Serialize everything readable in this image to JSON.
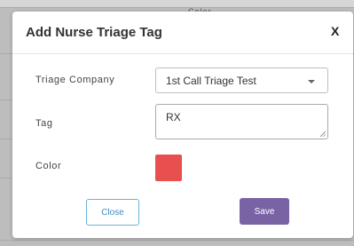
{
  "background": {
    "peek_text": "Color"
  },
  "dialog": {
    "title": "Add Nurse Triage Tag",
    "close_glyph": "X"
  },
  "form": {
    "triage_company_label": "Triage Company",
    "triage_company_value": "1st Call Triage Test",
    "tag_label": "Tag",
    "tag_value": "RX",
    "color_label": "Color",
    "color_value": "#e85050"
  },
  "buttons": {
    "close_label": "Close",
    "save_label": "Save",
    "save_color": "#7a63a5"
  },
  "icons": {
    "dropdown": "chevron-down-icon",
    "resize": "resize-grip-icon"
  }
}
